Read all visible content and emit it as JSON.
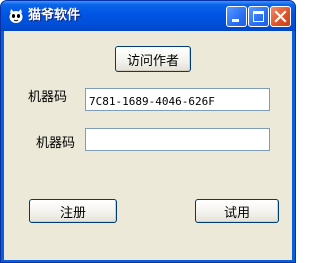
{
  "window": {
    "title": "猫爷软件"
  },
  "main": {
    "visit_author_label": "访问作者",
    "machine_code_label": "机器码",
    "machine_code_value": "7C81-1689-4046-626F",
    "register_code_label": "机器码",
    "register_code_value": "",
    "register_button_label": "注册",
    "trial_button_label": "试用"
  }
}
